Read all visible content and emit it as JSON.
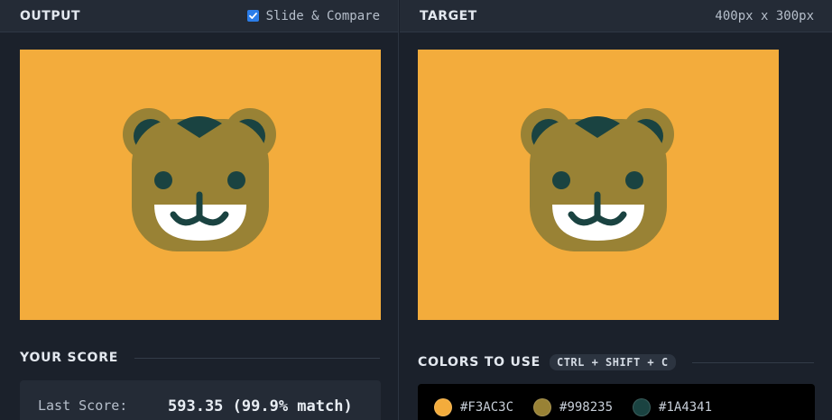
{
  "output": {
    "title": "OUTPUT",
    "slide_compare_label": "Slide & Compare",
    "slide_compare_checked": true
  },
  "target": {
    "title": "TARGET",
    "dimensions": "400px x 300px"
  },
  "score": {
    "title": "YOUR SCORE",
    "last_score_label": "Last Score:",
    "last_score_value": "593.35 (99.9% match)"
  },
  "colors": {
    "title": "COLORS TO USE",
    "shortcut": "CTRL + SHIFT + C",
    "palette": [
      {
        "hex": "#F3AC3C"
      },
      {
        "hex": "#998235"
      },
      {
        "hex": "#1A4341"
      }
    ]
  },
  "theme": {
    "background": "#F3AC3C",
    "face": "#998235",
    "dark": "#1A4341",
    "white": "#FFFFFF",
    "accent_checkbox": "#2B7DE9"
  }
}
